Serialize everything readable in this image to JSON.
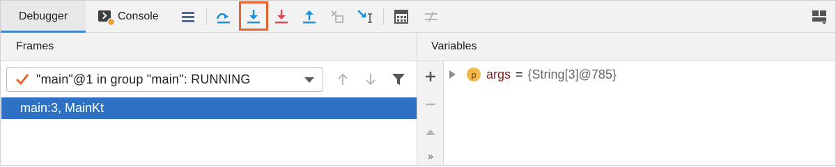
{
  "tabs": {
    "debugger": "Debugger",
    "console": "Console"
  },
  "toolbar": {
    "buttons": [
      "restore-layout-icon",
      "step-over-icon",
      "step-into-icon",
      "force-step-into-icon",
      "step-out-icon",
      "drop-frame-icon",
      "run-to-cursor-icon",
      "evaluate-expression-icon",
      "trace-current-stream-icon",
      "layout-settings-icon"
    ],
    "highlighted_button": "step-into-icon",
    "colors": {
      "accent_blue": "#1a8fd6",
      "step_red": "#e0454c",
      "highlight_orange": "#e8612c",
      "selection": "#2e70c4"
    }
  },
  "frames": {
    "header": "Frames",
    "thread": "\"main\"@1 in group \"main\": RUNNING",
    "rows": [
      "main:3, MainKt"
    ]
  },
  "variables": {
    "header": "Variables",
    "items": [
      {
        "badge": "p",
        "name": "args",
        "equals": "=",
        "value": "{String[3]@785}"
      }
    ],
    "tools": [
      "plus-icon",
      "minus-icon",
      "up-icon",
      "more-icon"
    ],
    "more_label": "»"
  }
}
